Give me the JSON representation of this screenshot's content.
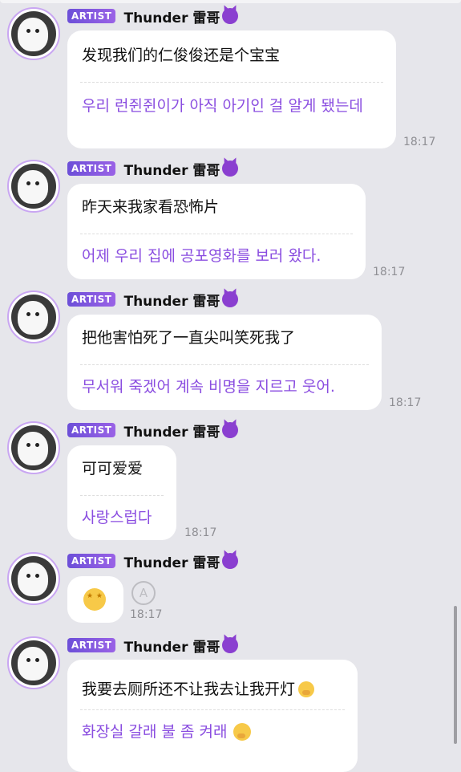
{
  "badge_label": "ARTIST",
  "sender_name": "Thunder 雷哥",
  "messages": [
    {
      "zh": "发现我们的仁俊俊还是个宝宝",
      "ko": "우리 런쥔쥔이가 아직 아기인 걸 알게 됐는데",
      "time": "18:17"
    },
    {
      "zh": "昨天来我家看恐怖片",
      "ko": "어제 우리 집에 공포영화를 보러 왔다.",
      "time": "18:17"
    },
    {
      "zh": "把他害怕死了一直尖叫笑死我了",
      "ko": "무서워 죽겠어 계속 비명을 지르고 웃어.",
      "time": "18:17"
    },
    {
      "zh": "可可爱爱",
      "ko": "사랑스럽다",
      "time": "18:17"
    },
    {
      "emoji_name": "star-struck-emoji",
      "time": "18:17"
    },
    {
      "zh": "我要去厕所还不让我去让我开灯",
      "ko": "화장실 갈래 불 좀 켜래"
    }
  ],
  "icons": {
    "devil": "smiling-devil-icon",
    "translate": "translate-icon",
    "hush": "shushing-face-emoji"
  }
}
